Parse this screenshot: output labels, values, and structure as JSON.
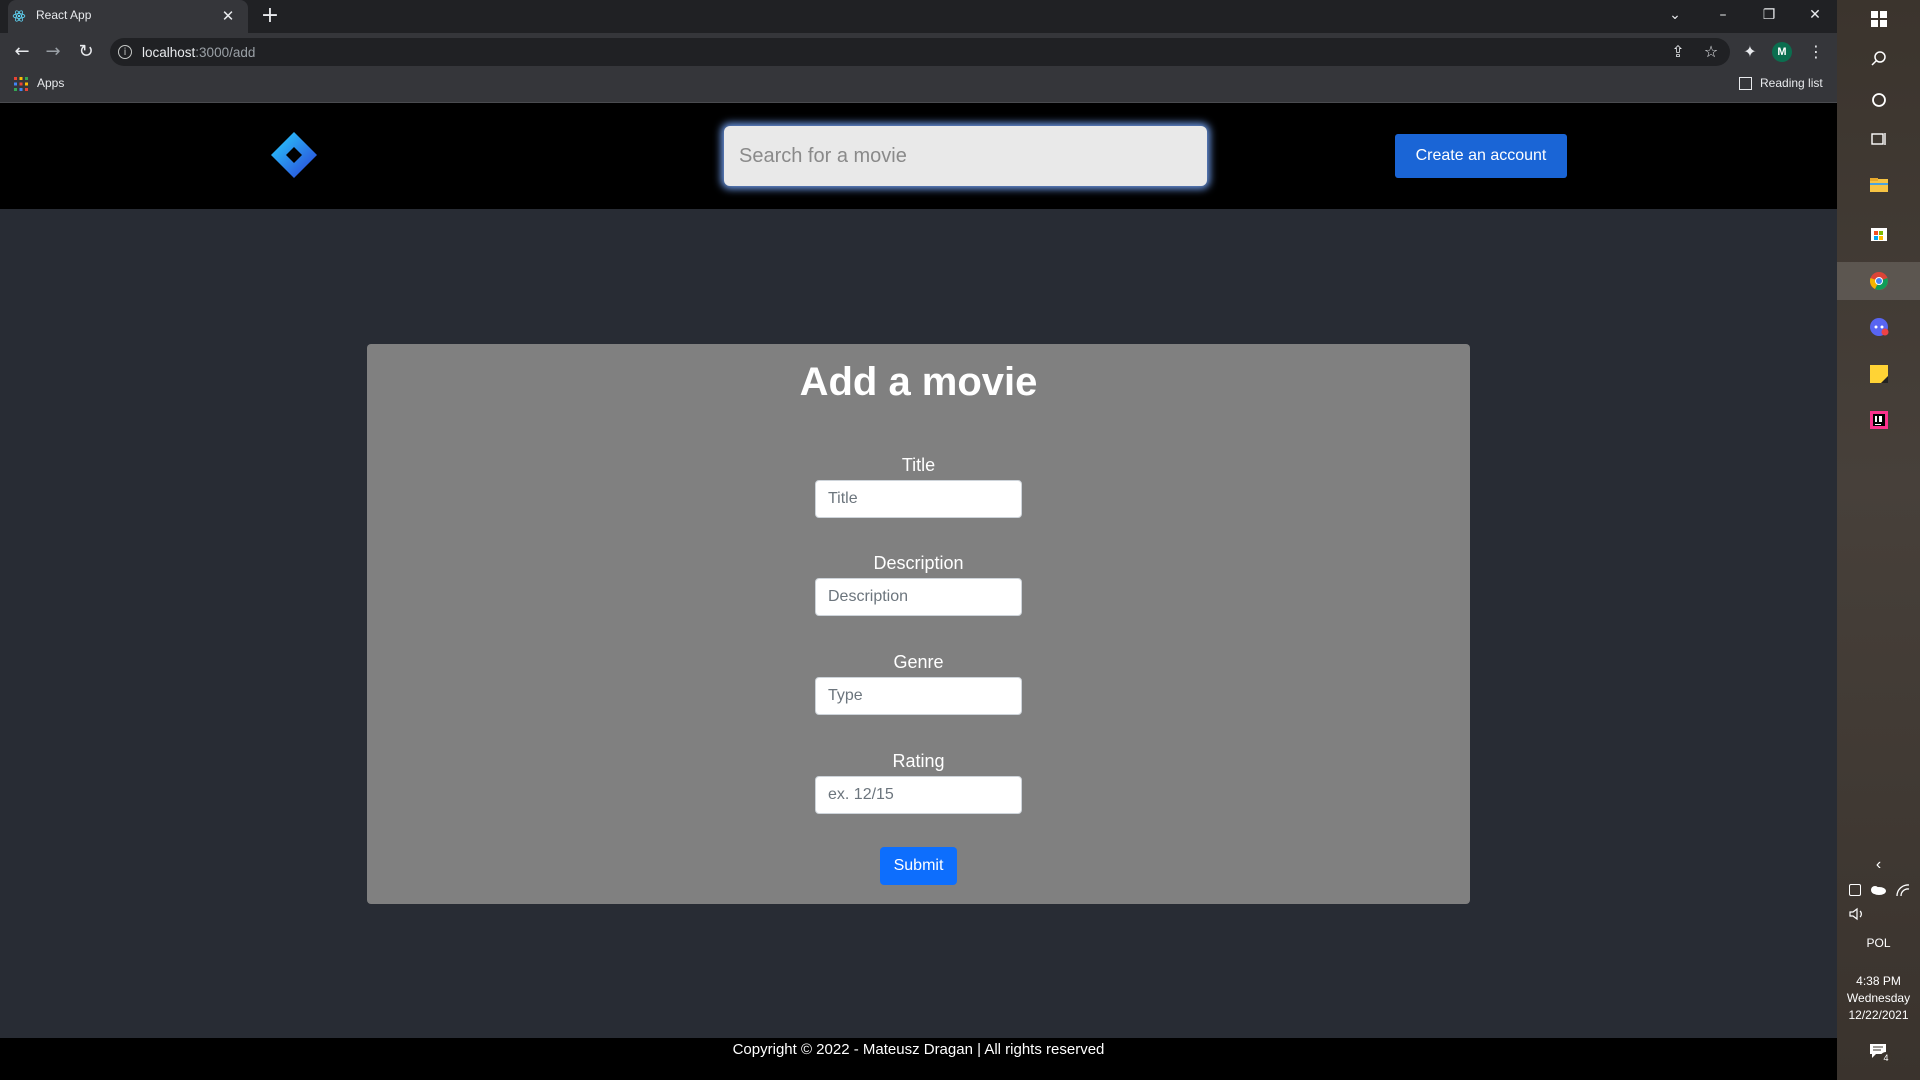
{
  "browser": {
    "tab_title": "React App",
    "tab_close": "✕",
    "new_tab": "+",
    "url_host": "localhost",
    "url_path": ":3000/add",
    "bookmarks_apps": "Apps",
    "reading_list": "Reading list",
    "profile_initial": "M",
    "window_controls": {
      "tab_search": "⌄",
      "minimize": "–",
      "restore": "❐",
      "close": "✕"
    },
    "nav": {
      "back": "←",
      "forward": "→",
      "reload": "↻"
    },
    "toolbar_icons": {
      "share": "⇪",
      "bookmark": "☆",
      "extensions": "✦",
      "menu": "⋮"
    }
  },
  "header": {
    "search_placeholder": "Search for a movie",
    "create_account_label": "Create an account"
  },
  "form": {
    "title": "Add a movie",
    "fields": [
      {
        "label": "Title",
        "placeholder": "Title"
      },
      {
        "label": "Description",
        "placeholder": "Description"
      },
      {
        "label": "Genre",
        "placeholder": "Type"
      },
      {
        "label": "Rating",
        "placeholder": "ex. 12/15"
      }
    ],
    "submit_label": "Submit"
  },
  "footer": {
    "text": "Copyright © 2022 - Mateusz Dragan | All rights reserved"
  },
  "taskbar": {
    "language": "POL",
    "time": "4:38 PM",
    "day": "Wednesday",
    "date": "12/22/2021",
    "notification_count": "4",
    "chevron": "‹",
    "icons": [
      "windows-start-icon",
      "search-icon",
      "cortana-icon",
      "task-view-icon",
      "file-explorer-icon",
      "store-icon",
      "chrome-icon",
      "discord-icon",
      "sticky-notes-icon",
      "intellij-icon"
    ]
  },
  "colors": {
    "page_bg": "#282c34",
    "panel_bg": "#808080",
    "header_bg": "#000000",
    "account_button": "#1a65d6",
    "submit_button": "#0d6efd"
  }
}
